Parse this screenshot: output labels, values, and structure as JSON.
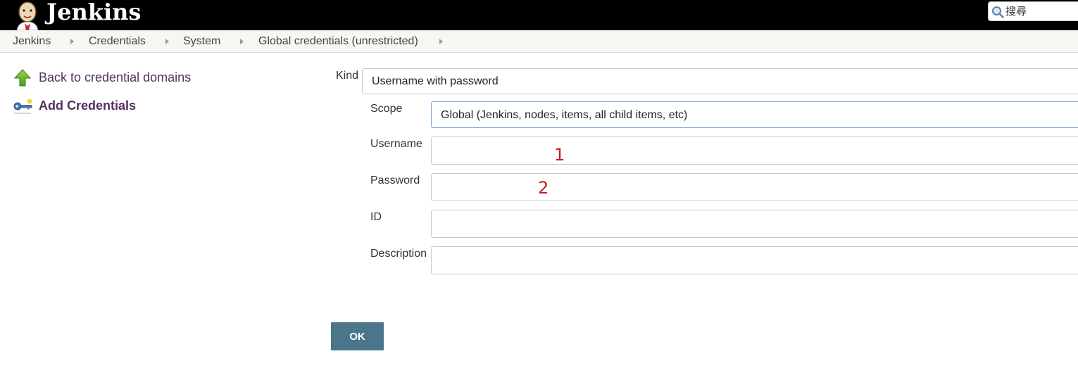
{
  "header": {
    "brand": "Jenkins",
    "search_placeholder": "搜尋"
  },
  "breadcrumb": [
    "Jenkins",
    "Credentials",
    "System",
    "Global credentials (unrestricted)"
  ],
  "sidebar": {
    "back_label": "Back to credential domains",
    "add_label": "Add Credentials"
  },
  "form": {
    "kind_label": "Kind",
    "kind_value": "Username with password",
    "scope_label": "Scope",
    "scope_value": "Global (Jenkins, nodes, items, all child items, etc)",
    "username_label": "Username",
    "username_value": "",
    "password_label": "Password",
    "password_value": "",
    "id_label": "ID",
    "id_value": "",
    "description_label": "Description",
    "description_value": "",
    "ok_label": "OK"
  },
  "annotations": [
    "1",
    "2"
  ],
  "colors": {
    "header_bg": "#000000",
    "breadcrumb_bg": "#f6f7f2",
    "link": "#53325e",
    "ok_button": "#4b758b",
    "annotation": "#c81b1b"
  }
}
